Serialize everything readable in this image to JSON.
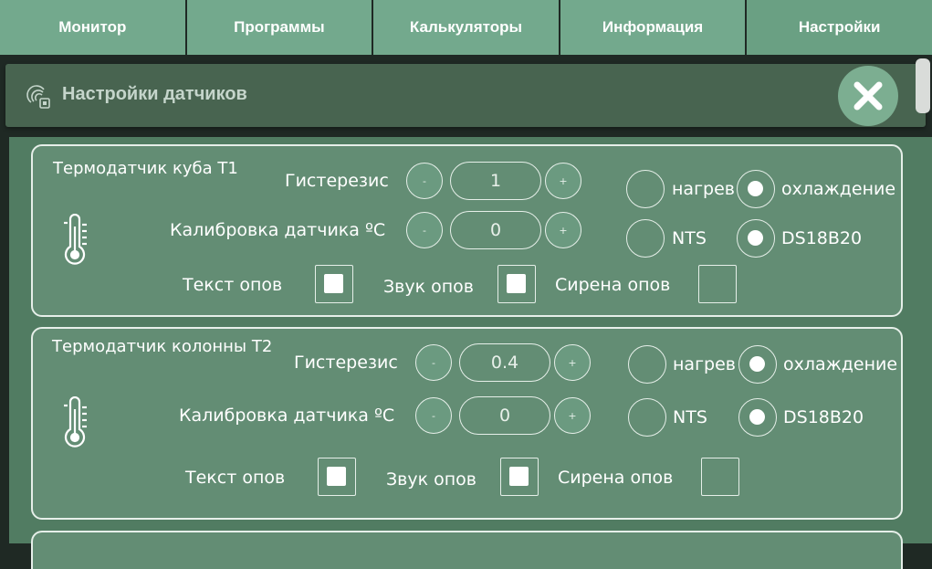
{
  "tabs": [
    {
      "label": "Монитор"
    },
    {
      "label": "Программы"
    },
    {
      "label": "Калькуляторы"
    },
    {
      "label": "Информация"
    },
    {
      "label": "Настройки"
    }
  ],
  "active_tab": "Настройки",
  "header": {
    "title": "Настройки датчиков"
  },
  "sensors": [
    {
      "name": "Термодатчик куба Т1",
      "hysteresis_label": "Гистерезис",
      "hysteresis_value": "1",
      "calibration_label": "Калибровка датчика ºС",
      "calibration_value": "0",
      "minus": "-",
      "plus": "+",
      "mode_heat": "нагрев",
      "mode_cool": "охлаждение",
      "mode_selected": "охлаждение",
      "type_nts": "NTS",
      "type_ds": "DS18B20",
      "type_selected": "DS18B20",
      "alert_text": "Текст опов",
      "alert_sound": "Звук опов",
      "alert_siren": "Сирена опов",
      "alert_text_checked": true,
      "alert_sound_checked": true,
      "alert_siren_checked": false
    },
    {
      "name": "Термодатчик колонны Т2",
      "hysteresis_label": "Гистерезис",
      "hysteresis_value": "0.4",
      "calibration_label": "Калибровка датчика ºС",
      "calibration_value": "0",
      "minus": "-",
      "plus": "+",
      "mode_heat": "нагрев",
      "mode_cool": "охлаждение",
      "mode_selected": "охлаждение",
      "type_nts": "NTS",
      "type_ds": "DS18B20",
      "type_selected": "DS18B20",
      "alert_text": "Текст опов",
      "alert_sound": "Звук опов",
      "alert_siren": "Сирена опов",
      "alert_text_checked": true,
      "alert_sound_checked": true,
      "alert_siren_checked": false
    }
  ],
  "icons": {
    "header": "sensor-settings-icon",
    "close": "close-icon",
    "sensor": "thermometer-icon"
  },
  "colors": {
    "tab": "#73a98d",
    "header": "#486450",
    "content": "#517c62",
    "card": "#638d74",
    "border": "#e6efe9"
  }
}
